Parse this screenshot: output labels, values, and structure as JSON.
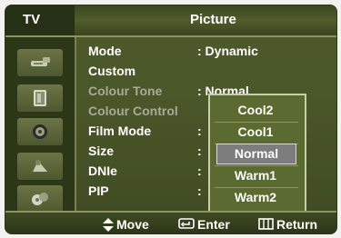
{
  "header": {
    "tv_label": "TV",
    "title": "Picture"
  },
  "sidebar": {
    "icons": [
      "antenna-icon",
      "picture-icon",
      "sound-icon",
      "setup-icon",
      "input-icon"
    ]
  },
  "menu": {
    "items": [
      {
        "label": "Mode",
        "value": ": Dynamic",
        "enabled": true
      },
      {
        "label": "Custom",
        "value": "",
        "enabled": true
      },
      {
        "label": "Colour Tone",
        "value": ": Normal",
        "enabled": false
      },
      {
        "label": "Colour Control",
        "value": "",
        "enabled": false
      },
      {
        "label": "Film Mode",
        "value": ":",
        "enabled": true
      },
      {
        "label": "Size",
        "value": ":",
        "enabled": true
      },
      {
        "label": "DNIe",
        "value": ":",
        "enabled": true
      },
      {
        "label": "PIP",
        "value": ":",
        "enabled": true
      }
    ]
  },
  "popup": {
    "options": [
      "Cool2",
      "Cool1",
      "Normal",
      "Warm1",
      "Warm2"
    ],
    "selected": "Normal"
  },
  "footer": {
    "move": "Move",
    "enter": "Enter",
    "return": "Return"
  },
  "colors": {
    "background": "#4a5729",
    "selected": "#7d7d7d",
    "border": "#c7cfa8"
  }
}
